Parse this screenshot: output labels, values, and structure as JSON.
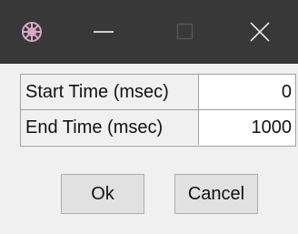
{
  "window": {
    "icon": "app-knot-icon",
    "controls": [
      "minimize-icon",
      "maximize-icon",
      "close-icon"
    ],
    "colors": {
      "titlebar": "#383838",
      "control_glyph": "#ffffff",
      "body": "#f0f0f0"
    }
  },
  "params": [
    {
      "label": "Start Time (msec)",
      "value": "0"
    },
    {
      "label": "End Time (msec)",
      "value": "1000"
    }
  ],
  "buttons": {
    "ok_label": "Ok",
    "cancel_label": "Cancel"
  }
}
